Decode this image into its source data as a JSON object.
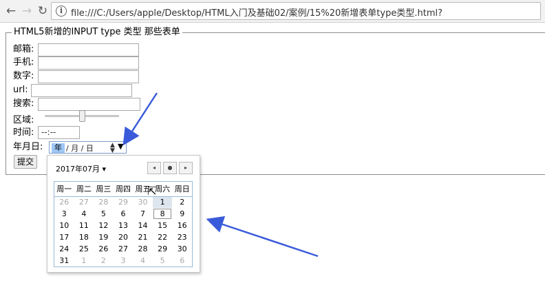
{
  "browser": {
    "back_icon": "←",
    "forward_icon": "→",
    "reload_icon": "↻",
    "info_icon": "i",
    "url": "file:///C:/Users/apple/Desktop/HTML入门及基础02/案例/15%20新增表单type类型.html?"
  },
  "form": {
    "legend": "HTML5新增的INPUT type 类型 那些表单",
    "fields": {
      "email_label": "邮箱:",
      "phone_label": "手机:",
      "number_label": "数字:",
      "url_label": "url:",
      "search_label": "搜索:",
      "range_label": "区域:",
      "time_label": "时间:",
      "time_value": "--:--",
      "date_label": "年月日:",
      "date_year": "年",
      "date_rest": "/ 月 / 日",
      "spin_up": "▲",
      "spin_down": "▼",
      "dropdown_icon": "▼"
    },
    "submit": "提交",
    "range_fraction": 0.5
  },
  "calendar": {
    "month_label": "2017年07月 ▾",
    "prev_icon": "◂",
    "today_icon": "●",
    "next_icon": "▸",
    "weekdays": [
      "周一",
      "周二",
      "周三",
      "周四",
      "周五",
      "周六",
      "周日"
    ],
    "weeks": [
      [
        "26",
        "27",
        "28",
        "29",
        "30",
        "1",
        "2"
      ],
      [
        "3",
        "4",
        "5",
        "6",
        "7",
        "8",
        "9"
      ],
      [
        "10",
        "11",
        "12",
        "13",
        "14",
        "15",
        "16"
      ],
      [
        "17",
        "18",
        "19",
        "20",
        "21",
        "22",
        "23"
      ],
      [
        "24",
        "25",
        "26",
        "27",
        "28",
        "29",
        "30"
      ],
      [
        "31",
        "1",
        "2",
        "3",
        "4",
        "5",
        "6"
      ]
    ],
    "dimmed": [
      [
        0,
        0
      ],
      [
        0,
        1
      ],
      [
        0,
        2
      ],
      [
        0,
        3
      ],
      [
        0,
        4
      ],
      [
        5,
        1
      ],
      [
        5,
        2
      ],
      [
        5,
        3
      ],
      [
        5,
        4
      ],
      [
        5,
        5
      ],
      [
        5,
        6
      ]
    ],
    "highlighted": [
      0,
      5
    ],
    "selected": [
      1,
      5
    ]
  },
  "colors": {
    "arrow": "#3a5bd9",
    "year_highlight": "#9ec7f5"
  }
}
